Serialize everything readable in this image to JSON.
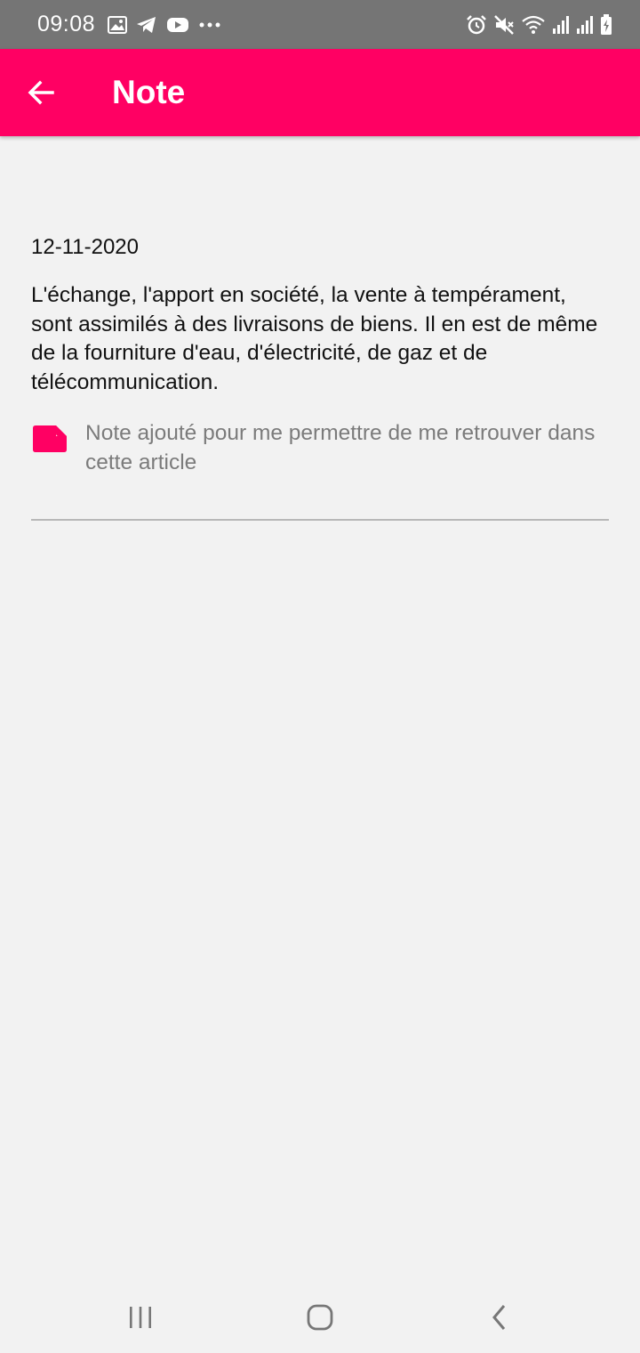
{
  "status_bar": {
    "time": "09:08",
    "left_icons": [
      "image-icon",
      "telegram-icon",
      "youtube-icon",
      "more-icon"
    ],
    "right_icons": [
      "alarm-icon",
      "mute-icon",
      "wifi-icon",
      "signal-icon",
      "signal-icon",
      "battery-charging-icon"
    ]
  },
  "app_bar": {
    "title": "Note",
    "back_icon": "arrow-back-icon",
    "color": "#ff0063"
  },
  "note": {
    "date": "12-11-2020",
    "text": "L'échange, l'apport en société, la vente à tempérament, sont assimilés à des livraisons de biens. Il en est de même de la fourniture d'eau, d'électricité, de gaz et de télécommunication.",
    "comment_icon": "note-icon",
    "comment": "Note ajouté pour me permettre de me retrouver dans cette article"
  },
  "nav_bar": {
    "buttons": [
      "recents-icon",
      "home-icon",
      "back-icon"
    ]
  }
}
